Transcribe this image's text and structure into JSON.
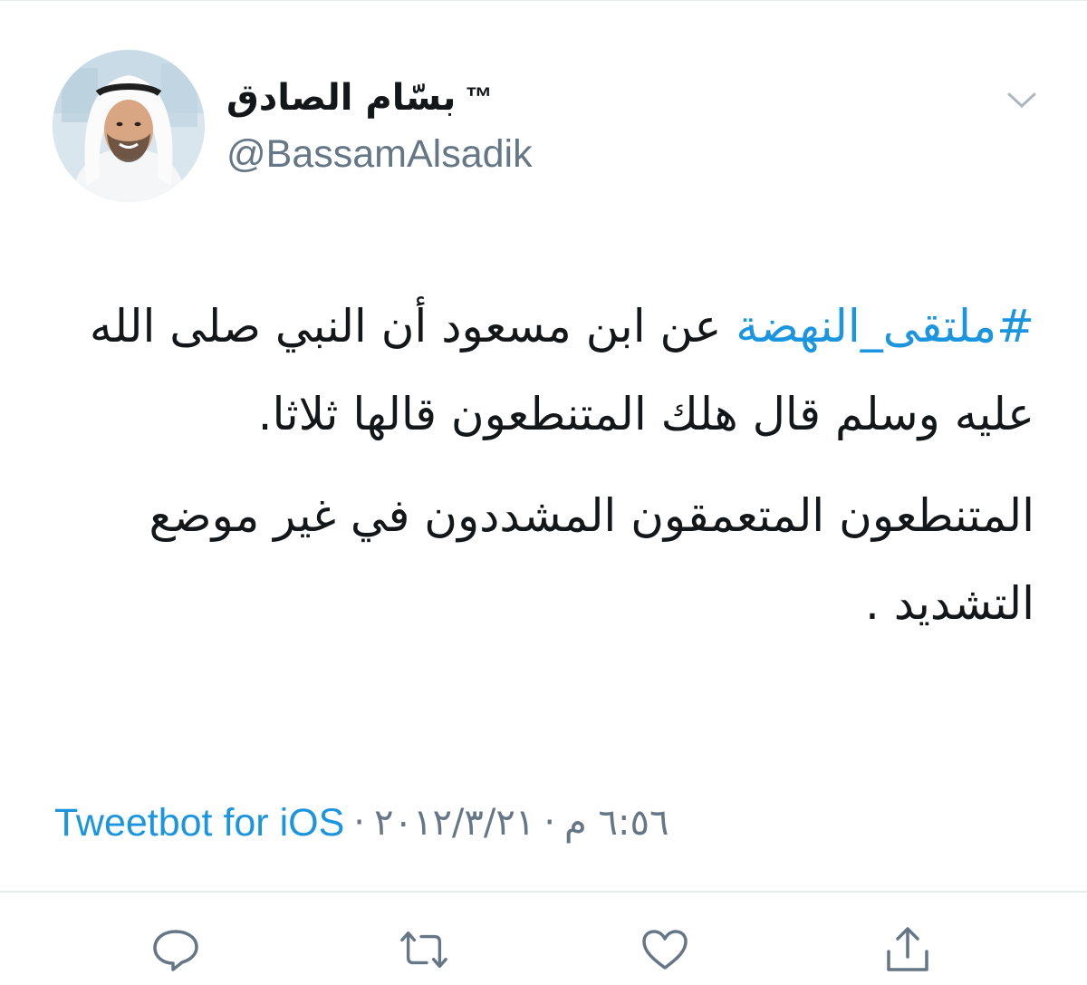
{
  "user": {
    "display_name": "بسّام الصادق",
    "trademark": "™",
    "handle": "@BassamAlsadik"
  },
  "tweet": {
    "hashtag": "#ملتقى_النهضة",
    "paragraph1_rest": " عن ابن مسعود أن النبي صلى الله عليه وسلم قال هلك المتنطعون قالها ثلاثا.",
    "paragraph2": "المتنطعون المتعمقون المشددون في غير موضع التشديد ."
  },
  "meta": {
    "source": "Tweetbot for iOS",
    "separator": "·",
    "date": "٢٠١٢/٣/٢١",
    "time": "٦:٥٦ م"
  },
  "colors": {
    "link": "#1b95e0",
    "text": "#14171a",
    "secondary": "#657786",
    "icon": "#657786"
  },
  "icons": {
    "menu": "chevron-down-icon",
    "reply": "reply-icon",
    "retweet": "retweet-icon",
    "like": "heart-icon",
    "share": "share-icon"
  }
}
